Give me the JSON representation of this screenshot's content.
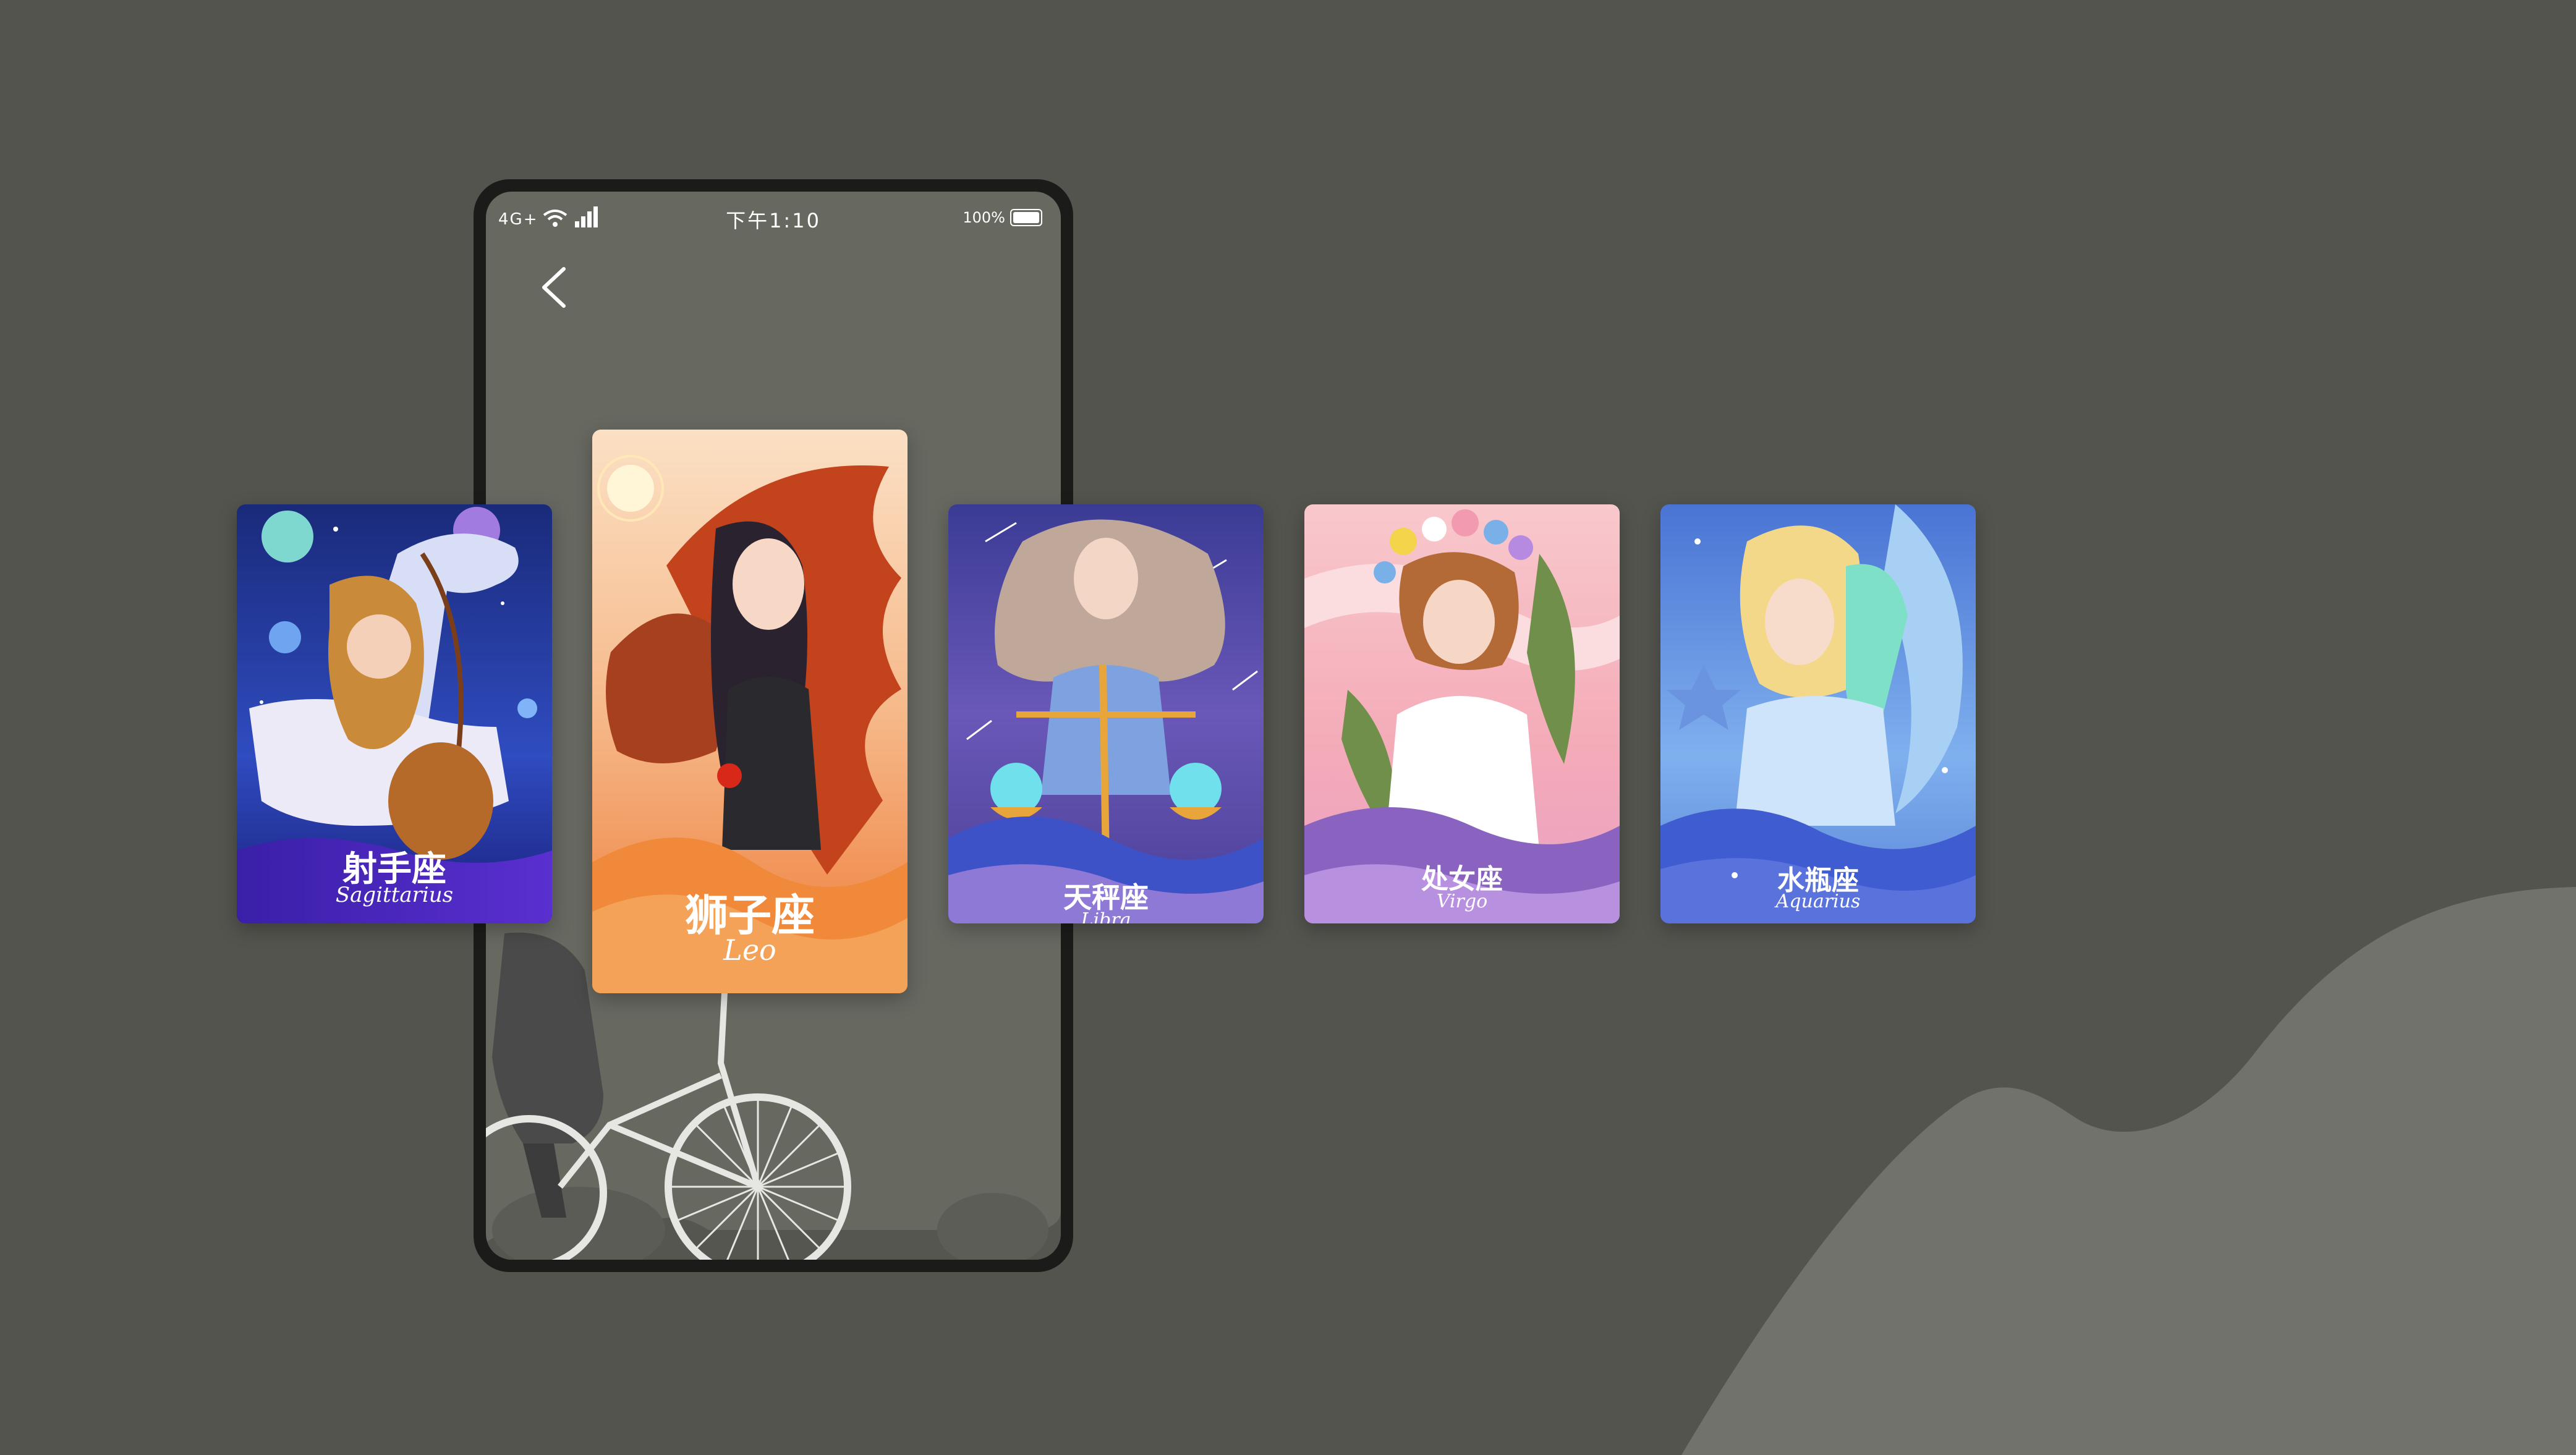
{
  "status_bar": {
    "network": "4G+",
    "time": "下午1:10",
    "battery": "100%"
  },
  "icons": {
    "back": "chevron-left-icon",
    "wifi": "wifi-icon",
    "signal": "signal-icon",
    "battery": "battery-icon"
  },
  "cards": [
    {
      "id": "sagittarius",
      "cn": "射手座",
      "en": "Sagittarius",
      "accent": "#1d2a8c"
    },
    {
      "id": "leo",
      "cn": "狮子座",
      "en": "Leo",
      "accent": "#e8743a"
    },
    {
      "id": "libra",
      "cn": "天秤座",
      "en": "Libra",
      "accent": "#4a3f96"
    },
    {
      "id": "virgo",
      "cn": "处女座",
      "en": "Virgo",
      "accent": "#f4b6c0"
    },
    {
      "id": "aquarius",
      "cn": "水瓶座",
      "en": "Aquarius",
      "accent": "#5a8fe0"
    }
  ],
  "colors": {
    "background": "#53544e",
    "phone_screen": "#676860",
    "phone_frame": "#1b1c1a"
  }
}
